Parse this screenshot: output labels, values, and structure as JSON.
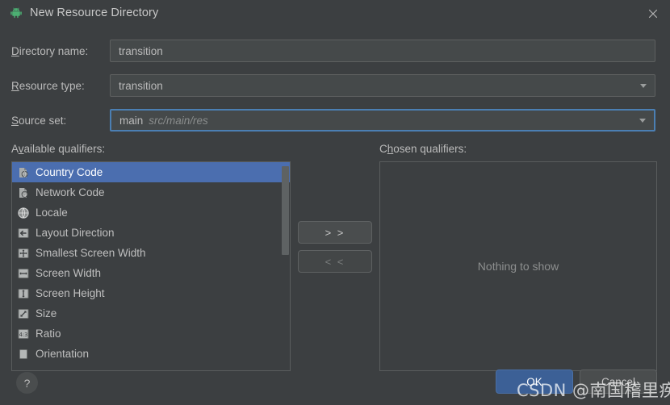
{
  "window": {
    "title": "New Resource Directory",
    "app_icon": "android-robot-icon",
    "close_label": "✕"
  },
  "form": {
    "directory_name": {
      "label_pre": "D",
      "label_mnemonic": "D",
      "label": "Directory name:",
      "label_head": "D",
      "label_tail": "irectory name:",
      "value": "transition"
    },
    "resource_type": {
      "label_head": "R",
      "label_tail": "esource type:",
      "value": "transition"
    },
    "source_set": {
      "label_head": "S",
      "label_tail": "ource set:",
      "value": "main",
      "hint": "src/main/res"
    }
  },
  "available": {
    "caption_head": "A",
    "caption_mid": "v",
    "caption_tail": "ailable qualifiers:",
    "items": [
      {
        "label": "Country Code",
        "icon": "country-code-icon",
        "selected": true
      },
      {
        "label": "Network Code",
        "icon": "network-code-icon",
        "selected": false
      },
      {
        "label": "Locale",
        "icon": "locale-globe-icon",
        "selected": false
      },
      {
        "label": "Layout Direction",
        "icon": "layout-direction-icon",
        "selected": false
      },
      {
        "label": "Smallest Screen Width",
        "icon": "smallest-screen-width-icon",
        "selected": false
      },
      {
        "label": "Screen Width",
        "icon": "screen-width-icon",
        "selected": false
      },
      {
        "label": "Screen Height",
        "icon": "screen-height-icon",
        "selected": false
      },
      {
        "label": "Size",
        "icon": "size-icon",
        "selected": false
      },
      {
        "label": "Ratio",
        "icon": "ratio-icon",
        "selected": false
      },
      {
        "label": "Orientation",
        "icon": "orientation-icon",
        "selected": false
      }
    ]
  },
  "transfer": {
    "add_label": "> >",
    "remove_label": "< <"
  },
  "chosen": {
    "caption_head": "C",
    "caption_mid": "h",
    "caption_tail": "osen qualifiers:",
    "empty_text": "Nothing to show"
  },
  "footer": {
    "help_label": "?",
    "ok_label": "OK",
    "cancel_label": "Cancel"
  },
  "watermark": {
    "text": "CSDN @南国稽里疾"
  },
  "colors": {
    "dialog_bg": "#3c3f41",
    "field_bg": "#45494a",
    "selection_blue": "#4b6eaf",
    "focus_blue": "#4b7fb3",
    "ok_blue": "#3c6096",
    "android_green": "#3ddc84",
    "text": "#bbbbbb"
  }
}
